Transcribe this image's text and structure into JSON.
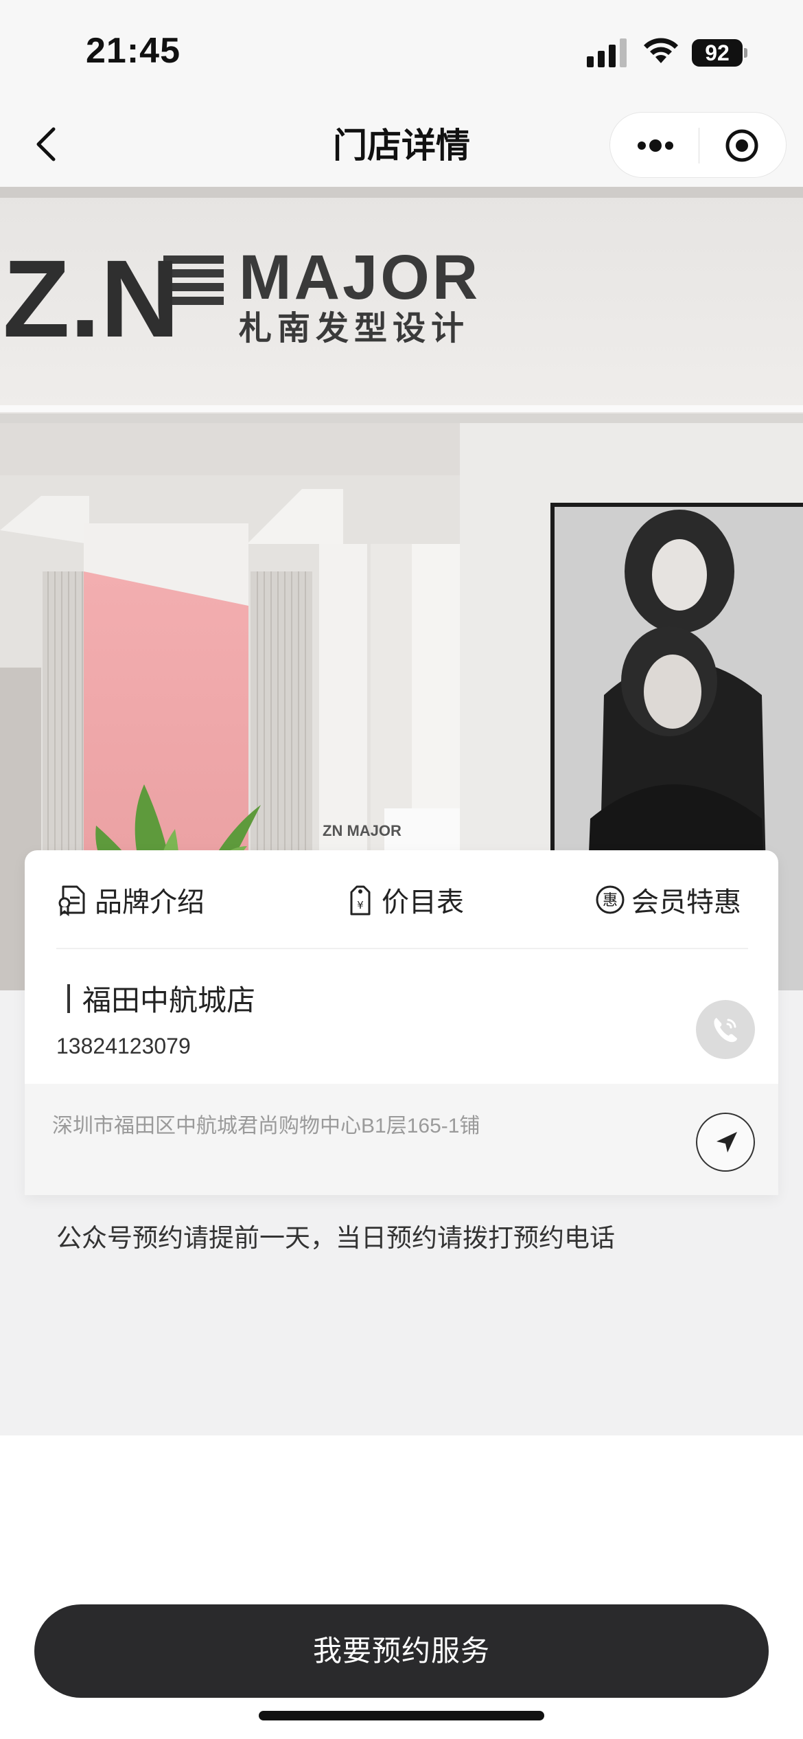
{
  "status_bar": {
    "time": "21:45",
    "battery": "92"
  },
  "nav": {
    "title": "门店详情"
  },
  "hero": {
    "logo_main": "Z.N",
    "logo_major": "MAJOR",
    "logo_sub": "札南发型设计",
    "wall_sign": "ZN MAJOR"
  },
  "tabs": [
    {
      "label": "品牌介绍",
      "icon": "brand-document-icon"
    },
    {
      "label": "价目表",
      "icon": "price-tag-icon"
    },
    {
      "label": "会员特惠",
      "icon": "member-discount-icon"
    }
  ],
  "store": {
    "name": "福田中航城店",
    "phone": "13824123079",
    "address": "深圳市福田区中航城君尚购物中心B1层165-1铺"
  },
  "notice": "公众号预约请提前一天，当日预约请拨打预约电话",
  "book_button": "我要预约服务"
}
